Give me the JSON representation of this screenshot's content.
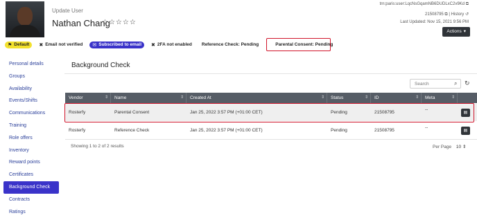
{
  "header": {
    "update_label": "Update User",
    "name": "Nathan Chang",
    "stars": "☆☆☆☆☆",
    "urn": "trn:paris:user:LqcNsGqamNB6DUDLxC2v9Kd",
    "id_line_id": "21508795",
    "id_line_history": "History",
    "last_updated": "Last Updated: Nov 15, 2021 9:56 PM",
    "actions_label": "Actions"
  },
  "chips": [
    {
      "icon": "flag-icon",
      "glyph": "⚑",
      "label": "Default"
    },
    {
      "icon": "close-circle-icon",
      "glyph": "✖",
      "label": "Email not verified"
    },
    {
      "icon": "email-icon",
      "glyph": "✉",
      "label": "Subscribed to email"
    },
    {
      "icon": "close-circle-icon",
      "glyph": "✖",
      "label": "2FA not enabled"
    },
    {
      "label": "Reference Check: Pending"
    },
    {
      "label": "Parental Consent: Pending"
    }
  ],
  "sidebar": {
    "items": [
      {
        "label": "Personal details"
      },
      {
        "label": "Groups"
      },
      {
        "label": "Availability"
      },
      {
        "label": "Events/Shifts"
      },
      {
        "label": "Communications"
      },
      {
        "label": "Training"
      },
      {
        "label": "Role offers"
      },
      {
        "label": "Inventory"
      },
      {
        "label": "Reward points"
      },
      {
        "label": "Certificates"
      },
      {
        "label": "Background Check",
        "active": true
      },
      {
        "label": "Contracts"
      },
      {
        "label": "Ratings"
      }
    ]
  },
  "main": {
    "title": "Background Check",
    "search_placeholder": "Search",
    "columns": [
      "Vendor",
      "Name",
      "Created At",
      "Status",
      "ID",
      "Meta"
    ],
    "rows": [
      {
        "vendor": "Rosterfy",
        "name": "Parental Consent",
        "created": "Jan 25, 2022 3:57 PM (+01:00 CET)",
        "status": "Pending",
        "id": "21508795",
        "meta": "--"
      },
      {
        "vendor": "Rosterfy",
        "name": "Reference Check",
        "created": "Jan 25, 2022 3:57 PM (+01:00 CET)",
        "status": "Pending",
        "id": "21508795",
        "meta": "--"
      }
    ],
    "showing": "Showing 1 to 2 of 2 results",
    "per_page_label": "Per Page",
    "per_page_value": "10"
  },
  "colors": {
    "accent": "#3a33c9",
    "default_chip": "#f3e12e",
    "highlight": "#d0142a",
    "table_header": "#565d66"
  }
}
